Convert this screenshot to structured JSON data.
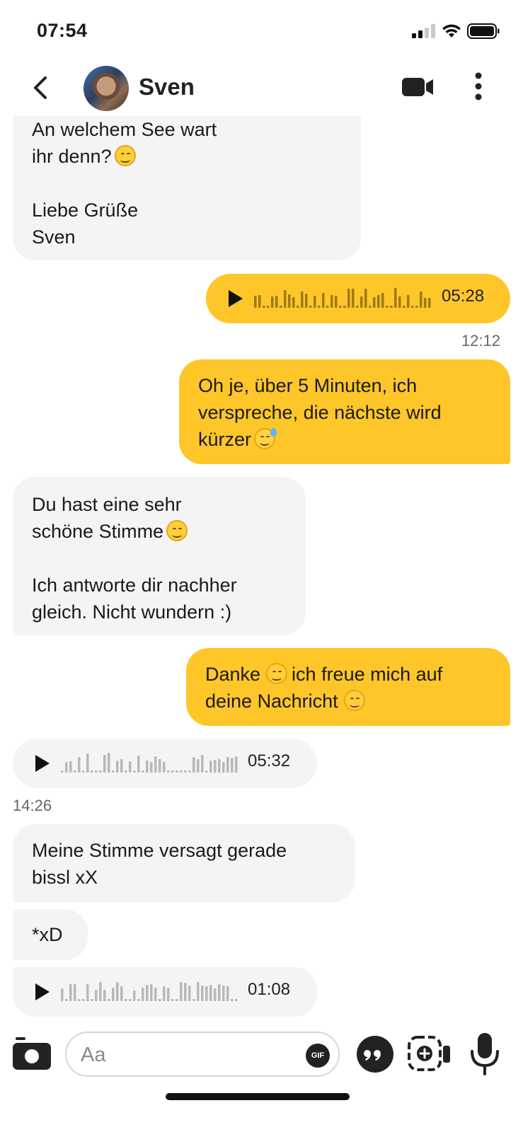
{
  "status_bar": {
    "time": "07:54"
  },
  "header": {
    "contact_name": "Sven"
  },
  "messages": {
    "m1": {
      "lines": [
        "An welchem See wart",
        "ihr denn?",
        "",
        "Liebe Grüße",
        "Sven"
      ]
    },
    "m2": {
      "duration": "05:28"
    },
    "t1": "12:12",
    "m3": {
      "lines": [
        "Oh je, über 5 Minuten, ich",
        "verspreche, die nächste wird",
        "kürzer"
      ]
    },
    "m4": {
      "lines": [
        "Du hast eine sehr",
        "schöne Stimme",
        "",
        "Ich antworte dir nachher",
        "gleich. Nicht wundern :)"
      ]
    },
    "m5": {
      "lines": [
        "Danke",
        "ich freue mich auf",
        "deine Nachricht"
      ]
    },
    "m6": {
      "duration": "05:32"
    },
    "t2": "14:26",
    "m7": {
      "lines": [
        "Meine Stimme versagt gerade",
        "bissl xX"
      ]
    },
    "m8": {
      "text": "*xD"
    },
    "m9": {
      "duration": "01:08"
    }
  },
  "composer": {
    "placeholder": "Aa",
    "gif_label": "GIF"
  },
  "colors": {
    "outgoing": "#ffc629",
    "incoming": "#f4f4f4",
    "waveform_out": "#9c7a16",
    "waveform_in": "#b8b8b8"
  }
}
